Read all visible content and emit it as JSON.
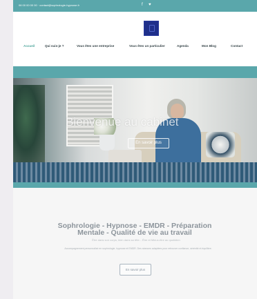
{
  "topbar": {
    "contact_text": "06 00 00 00 00  ·  contact@sophrologie-hypnose.fr",
    "social": [
      "f",
      "♥"
    ]
  },
  "nav": {
    "items": [
      {
        "label": "Accueil",
        "active": true
      },
      {
        "label": "Qui suis-je ?",
        "active": false
      },
      {
        "label": "Vous êtes une entreprise",
        "active": false
      },
      {
        "label": "Vous êtes un particulier",
        "active": false
      },
      {
        "label": "Agenda",
        "active": false
      },
      {
        "label": "Mon Blog",
        "active": false
      },
      {
        "label": "Contact",
        "active": false
      }
    ],
    "extra_symbol": "☰"
  },
  "hero": {
    "title": "Bienvenue au cabinet",
    "button_label": "En savoir plus"
  },
  "content": {
    "headline": "Sophrologie - Hypnose - EMDR - Préparation Mentale - Qualité de vie au travail",
    "subline": "Être dans son corps, bien dans sa tête... Être et Mieux-être au quotidien",
    "small_text": "Accompagnement personnalisé en sophrologie, hypnose et EMDR. Des séances adaptées pour retrouver confiance, sérénité et équilibre.",
    "cta_label": "En savoir plus"
  },
  "colors": {
    "teal": "#5aa7ab",
    "logo_blue": "#1f2f8a",
    "text_gray": "#8d959c",
    "background": "#efedf1"
  }
}
